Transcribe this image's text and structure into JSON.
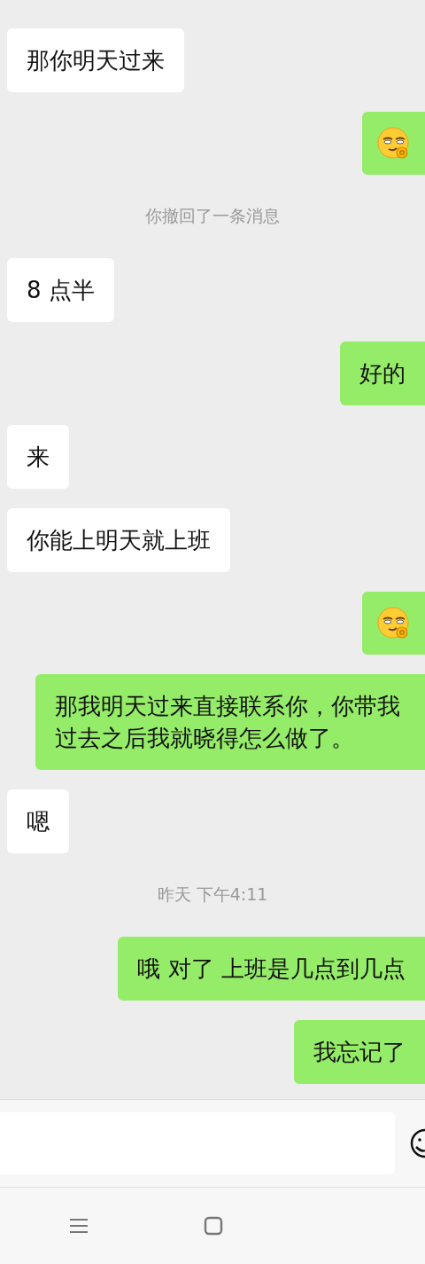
{
  "messages": [
    {
      "kind": "received",
      "text": "那你明天过来"
    },
    {
      "kind": "sticker"
    },
    {
      "kind": "system",
      "text": "你撤回了一条消息"
    },
    {
      "kind": "received",
      "text": "8 点半"
    },
    {
      "kind": "sent",
      "text": "好的"
    },
    {
      "kind": "received",
      "text": "来"
    },
    {
      "kind": "received",
      "text": "你能上明天就上班"
    },
    {
      "kind": "sticker"
    },
    {
      "kind": "sent",
      "text": "那我明天过来直接联系你，你带我过去之后我就晓得怎么做了。"
    },
    {
      "kind": "received",
      "text": "嗯"
    },
    {
      "kind": "system",
      "text": "昨天 下午4:11"
    },
    {
      "kind": "sent",
      "text": "哦 对了 上班是几点到几点"
    },
    {
      "kind": "sent",
      "text": "我忘记了"
    }
  ]
}
